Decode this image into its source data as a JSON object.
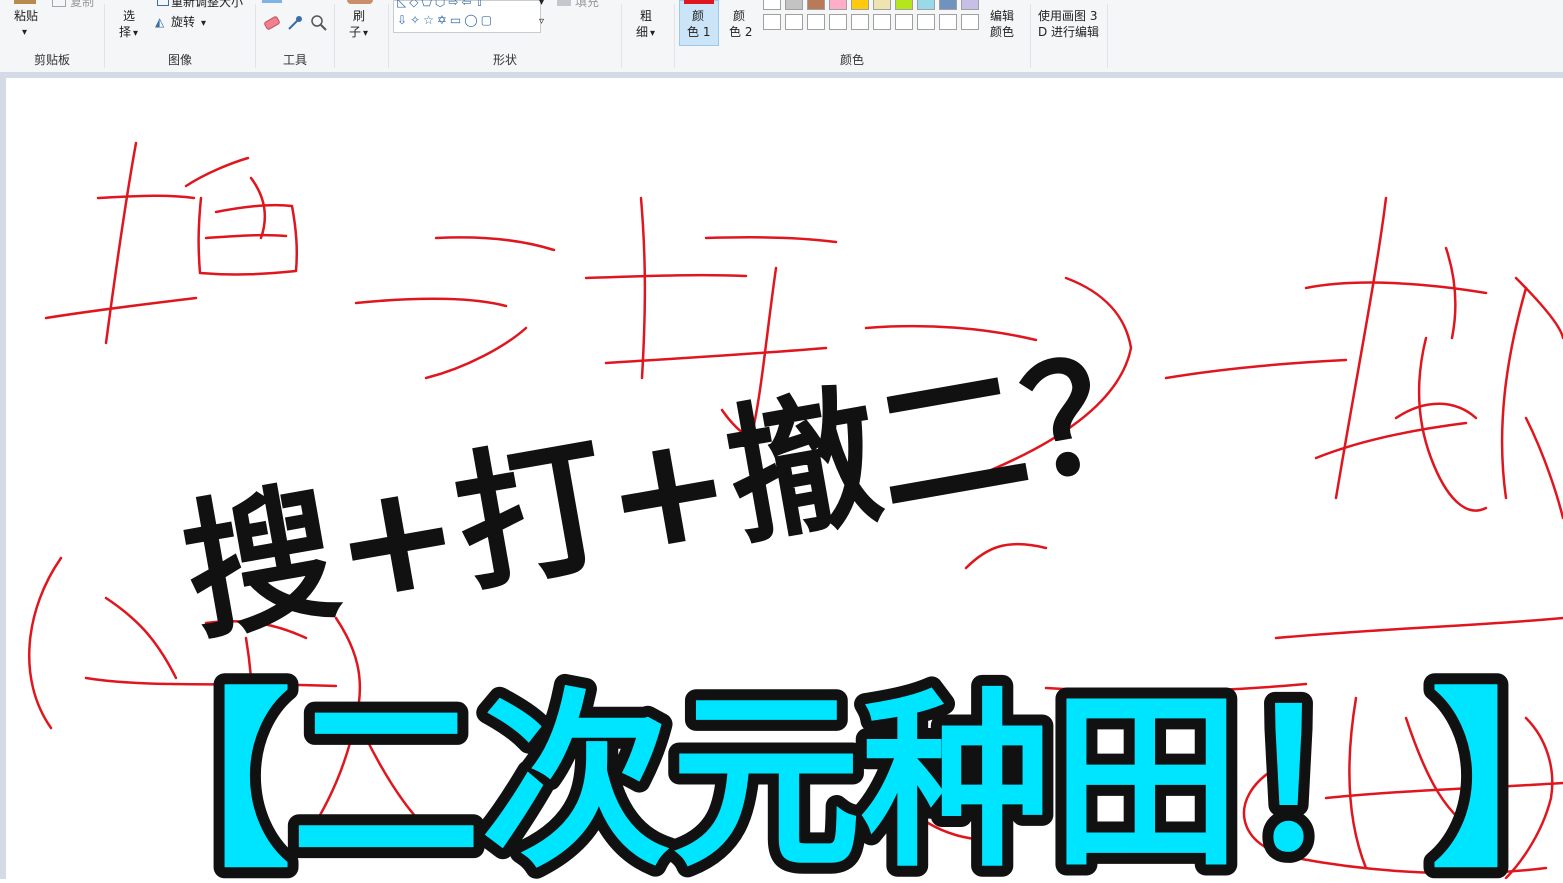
{
  "ribbon": {
    "clipboard": {
      "paste_label": "粘贴",
      "copy_label": "复制",
      "group_label": "剪贴板"
    },
    "image": {
      "select_label_top": "选",
      "select_label_bottom": "择",
      "resize_label": "重新调整大小",
      "rotate_label": "旋转",
      "group_label": "图像"
    },
    "tools": {
      "group_label": "工具"
    },
    "brushes": {
      "label_top": "刷",
      "label_bottom": "子"
    },
    "shapes": {
      "fill_label": "填充",
      "group_label": "形状"
    },
    "size": {
      "label_top": "粗",
      "label_bottom": "细"
    },
    "colors": {
      "color1_top": "颜",
      "color1_bottom": "色 1",
      "color2_top": "颜",
      "color2_bottom": "色 2",
      "edit_top": "编辑",
      "edit_bottom": "颜色",
      "group_label": "颜色",
      "palette_row1": [
        "#ffffff",
        "#c3c3c3",
        "#b97a57",
        "#ffaec9",
        "#ffc90e",
        "#efe4b0",
        "#b5e61d",
        "#99d9ea",
        "#7092be",
        "#c8bfe7"
      ]
    },
    "paint3d": {
      "line1": "使用画图 3",
      "line2": "D 进行编辑"
    }
  },
  "canvas": {
    "title_line1": "搜+打+撤二？",
    "title_line2": "【二次元种田！】",
    "accent_cyan": "#00e5ff",
    "scribble_red": "#e0161e"
  }
}
